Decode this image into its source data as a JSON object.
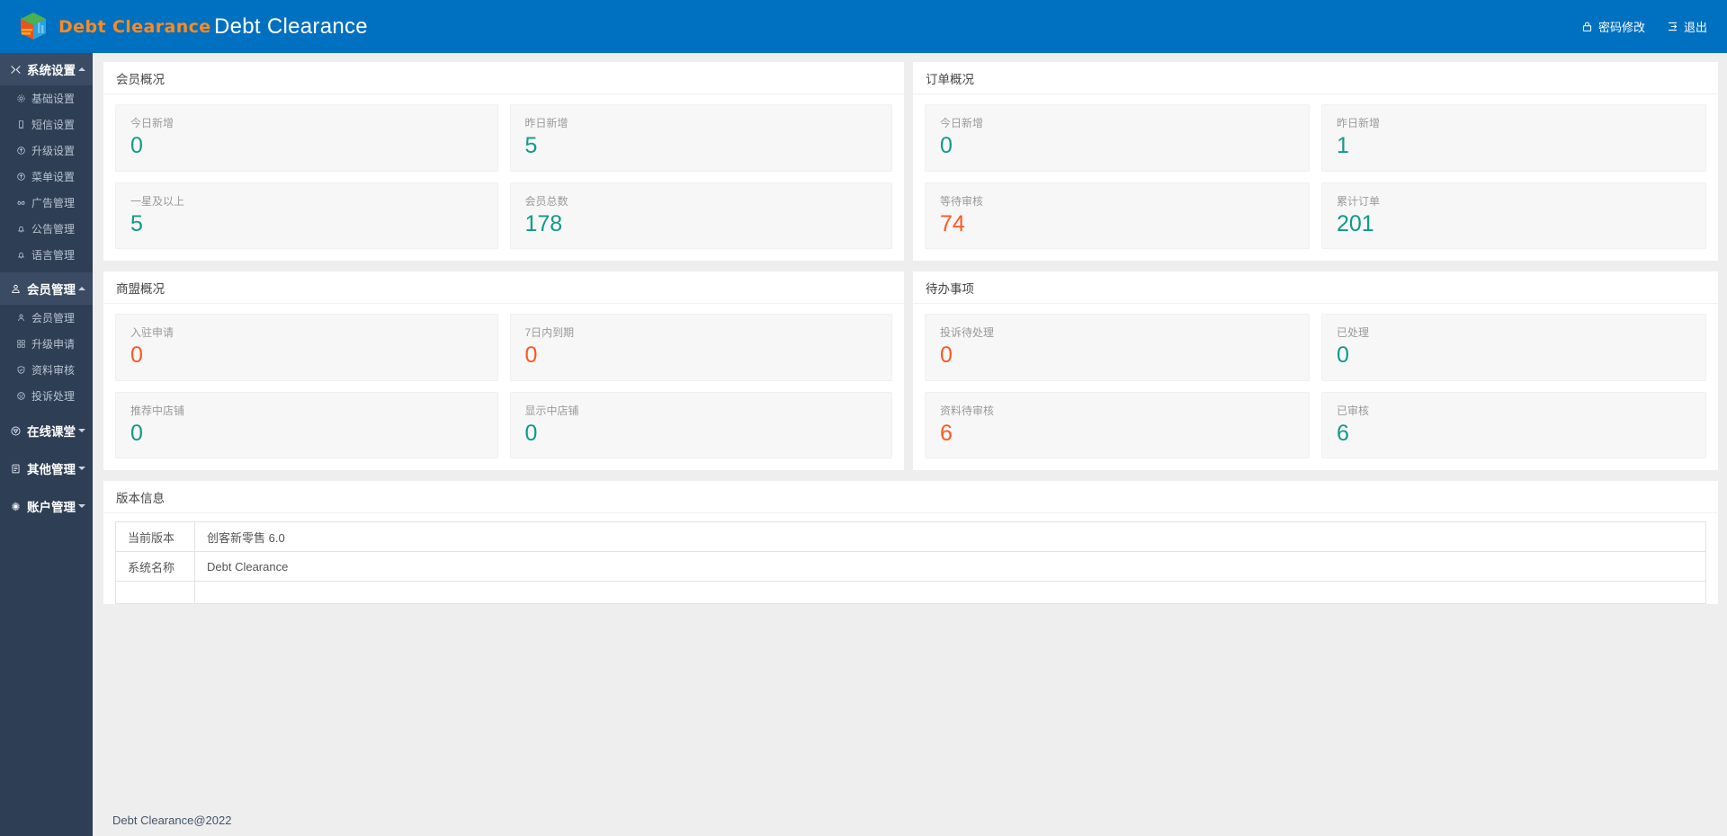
{
  "header": {
    "brand_text": "Debt Clearance",
    "title": "Debt Clearance",
    "logo_icon": "cube-logo-icon",
    "actions": [
      {
        "label": "密码修改",
        "icon": "lock-icon"
      },
      {
        "label": "退出",
        "icon": "exit-icon"
      }
    ]
  },
  "sidebar": {
    "groups": [
      {
        "label": "系统设置",
        "icon": "settings-group-icon",
        "active": true,
        "caret": "up",
        "items": [
          {
            "label": "基础设置",
            "icon": "gear-icon"
          },
          {
            "label": "短信设置",
            "icon": "mobile-icon"
          },
          {
            "label": "升级设置",
            "icon": "upgrade-icon"
          },
          {
            "label": "菜单设置",
            "icon": "menu-icon"
          },
          {
            "label": "广告管理",
            "icon": "ad-icon"
          },
          {
            "label": "公告管理",
            "icon": "bell-icon"
          },
          {
            "label": "语言管理",
            "icon": "bell-icon"
          }
        ]
      },
      {
        "label": "会员管理",
        "icon": "member-group-icon",
        "active": true,
        "caret": "up",
        "items": [
          {
            "label": "会员管理",
            "icon": "user-icon"
          },
          {
            "label": "升级申请",
            "icon": "grid-icon"
          },
          {
            "label": "资料审核",
            "icon": "shield-check-icon"
          },
          {
            "label": "投诉处理",
            "icon": "sad-face-icon"
          }
        ]
      },
      {
        "label": "在线课堂",
        "icon": "classroom-icon",
        "active": false,
        "caret": "down",
        "items": []
      },
      {
        "label": "其他管理",
        "icon": "document-icon",
        "active": false,
        "caret": "down",
        "items": []
      },
      {
        "label": "账户管理",
        "icon": "account-gear-icon",
        "active": false,
        "caret": "down",
        "items": []
      }
    ]
  },
  "panels": {
    "member_overview": {
      "title": "会员概况",
      "stats": [
        [
          {
            "label": "今日新增",
            "value": "0",
            "color": "teal"
          },
          {
            "label": "昨日新增",
            "value": "5",
            "color": "teal"
          }
        ],
        [
          {
            "label": "一星及以上",
            "value": "5",
            "color": "teal"
          },
          {
            "label": "会员总数",
            "value": "178",
            "color": "teal"
          }
        ]
      ]
    },
    "order_overview": {
      "title": "订单概况",
      "stats": [
        [
          {
            "label": "今日新增",
            "value": "0",
            "color": "teal"
          },
          {
            "label": "昨日新增",
            "value": "1",
            "color": "teal"
          }
        ],
        [
          {
            "label": "等待审核",
            "value": "74",
            "color": "orange"
          },
          {
            "label": "累计订单",
            "value": "201",
            "color": "teal"
          }
        ]
      ]
    },
    "merchant_overview": {
      "title": "商盟概况",
      "stats": [
        [
          {
            "label": "入驻申请",
            "value": "0",
            "color": "orange"
          },
          {
            "label": "7日内到期",
            "value": "0",
            "color": "orange"
          }
        ],
        [
          {
            "label": "推荐中店铺",
            "value": "0",
            "color": "teal"
          },
          {
            "label": "显示中店铺",
            "value": "0",
            "color": "teal"
          }
        ]
      ]
    },
    "todo": {
      "title": "待办事项",
      "stats": [
        [
          {
            "label": "投诉待处理",
            "value": "0",
            "color": "orange"
          },
          {
            "label": "已处理",
            "value": "0",
            "color": "teal"
          }
        ],
        [
          {
            "label": "资料待审核",
            "value": "6",
            "color": "orange"
          },
          {
            "label": "已审核",
            "value": "6",
            "color": "teal"
          }
        ]
      ]
    },
    "version_info": {
      "title": "版本信息",
      "rows": [
        {
          "key": "当前版本",
          "value": "创客新零售 6.0"
        },
        {
          "key": "系统名称",
          "value": "Debt Clearance"
        },
        {
          "key": "",
          "value": ""
        }
      ]
    }
  },
  "footer": {
    "text": "Debt Clearance@2022"
  },
  "colors": {
    "header_blue": "#0070c0",
    "sidebar_dark": "#2e3e54",
    "brand_orange": "#ff8a1f",
    "stat_teal": "#0e9b8a",
    "stat_orange": "#ff5722"
  }
}
